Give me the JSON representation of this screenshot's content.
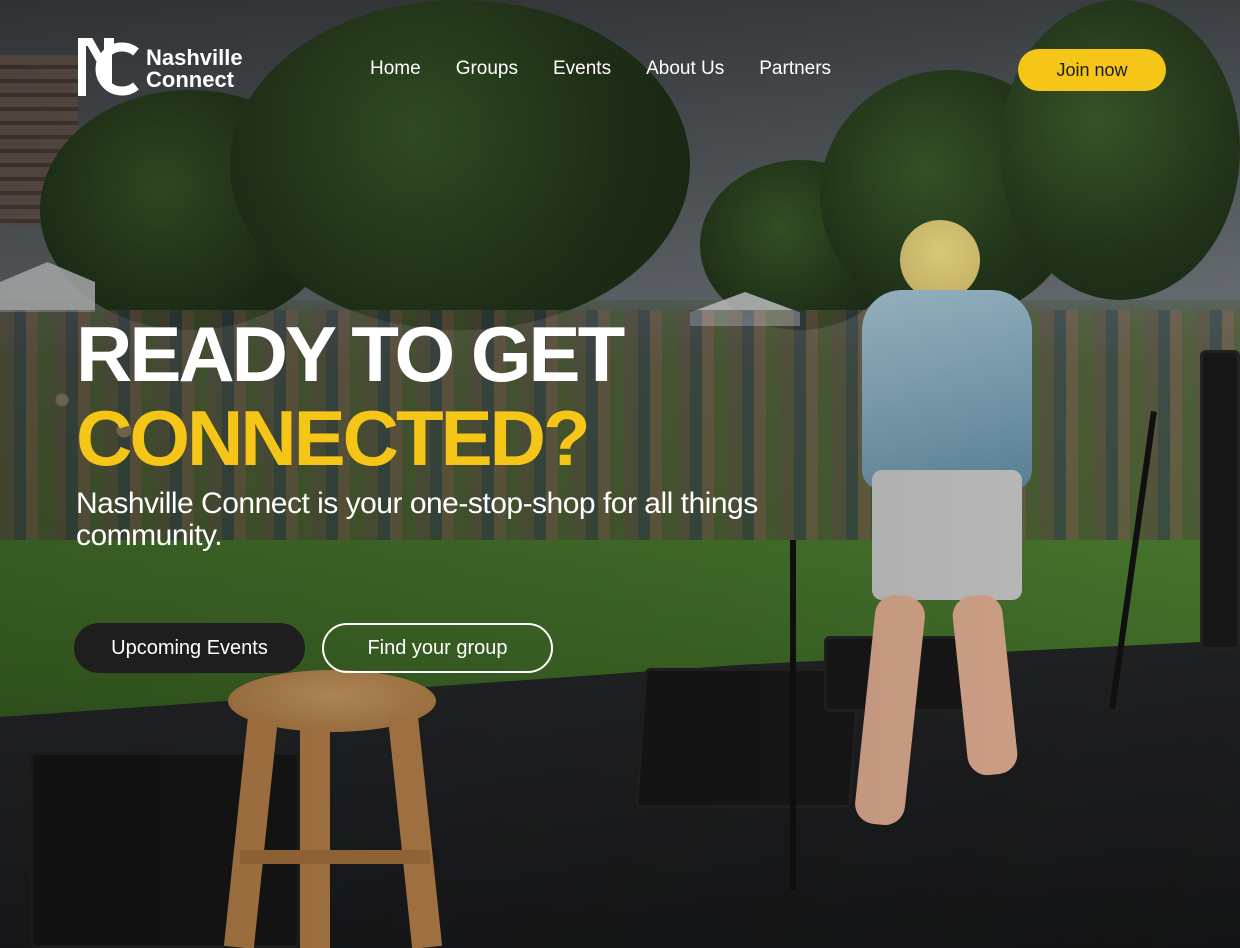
{
  "brand": {
    "name_line1": "Nashville",
    "name_line2": "Connect",
    "logo_icon": "nc-monogram-icon"
  },
  "nav": {
    "items": [
      {
        "label": "Home"
      },
      {
        "label": "Groups"
      },
      {
        "label": "Events"
      },
      {
        "label": "About Us"
      },
      {
        "label": "Partners"
      }
    ],
    "cta_label": "Join now"
  },
  "hero": {
    "title_line1": "READY TO GET",
    "title_line2": "CONNECTED?",
    "subtitle": "Nashville Connect is your one-stop-shop for all things community.",
    "primary_button": "Upcoming Events",
    "secondary_button": "Find your group"
  },
  "colors": {
    "accent": "#f5c518",
    "dark_button": "#1e1e1e",
    "text_light": "#ffffff"
  }
}
